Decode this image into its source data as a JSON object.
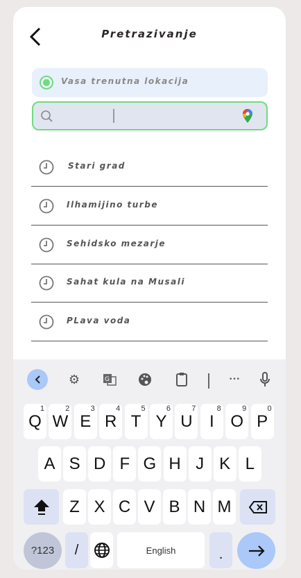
{
  "header": {
    "title": "Pretrazivanje"
  },
  "location": {
    "label": "Vasa trenutna lokacija"
  },
  "search": {
    "value": ""
  },
  "recent": [
    "Stari grad",
    "Ilhamijino turbe",
    "Sehidsko mezarje",
    "Sahat kula na Musali",
    "PLava voda"
  ],
  "keyboard": {
    "row1": [
      [
        "Q",
        "1"
      ],
      [
        "W",
        "2"
      ],
      [
        "E",
        "3"
      ],
      [
        "R",
        "4"
      ],
      [
        "T",
        "5"
      ],
      [
        "Y",
        "6"
      ],
      [
        "U",
        "7"
      ],
      [
        "I",
        "8"
      ],
      [
        "O",
        "9"
      ],
      [
        "P",
        "0"
      ]
    ],
    "row2": [
      "A",
      "S",
      "D",
      "F",
      "G",
      "H",
      "J",
      "K",
      "L"
    ],
    "row3": [
      "Z",
      "X",
      "C",
      "V",
      "B",
      "N",
      "M"
    ],
    "symbols": "?123",
    "slash": "/",
    "space": "English",
    "period": ".",
    "more": "•••"
  },
  "colors": {
    "accent": "#6fdc7e",
    "enter": "#aac8f8"
  }
}
